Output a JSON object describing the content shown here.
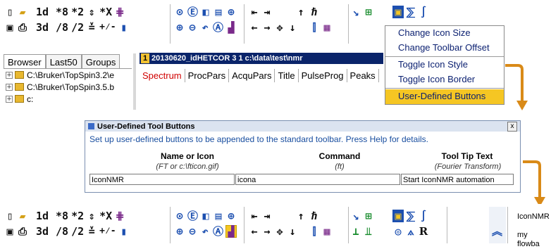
{
  "top_toolbar": {
    "row1": [
      "1d",
      "*8",
      "*2",
      "*X"
    ],
    "row2": [
      "3d",
      "/8",
      "/2"
    ]
  },
  "browser": {
    "tabs": [
      "Browser",
      "Last50",
      "Groups"
    ],
    "items": [
      "C:\\Bruker\\TopSpin3.2\\e",
      "C:\\Bruker\\TopSpin3.5.b",
      "c:"
    ]
  },
  "dataset": {
    "number": "1",
    "title": "20130620_idHETCOR 3 1 c:\\data\\test\\nmr",
    "tabs": [
      "Spectrum",
      "ProcPars",
      "AcquPars",
      "Title",
      "PulseProg",
      "Peaks"
    ]
  },
  "menu": {
    "items": [
      "Change Icon Size",
      "Change Toolbar Offset",
      "Toggle Icon Style",
      "Toggle Icon Border",
      "User-Defined Buttons"
    ]
  },
  "dialog": {
    "title": "User-Defined Tool Buttons",
    "close": "x",
    "description": "Set up user-defined buttons to be appended to the standard toolbar. Press Help for details.",
    "headers": [
      "Name or Icon",
      "Command",
      "Tool Tip Text"
    ],
    "subheaders": [
      "(FT or c:\\fticon.gif)",
      "(ft)",
      "(Fourier Transform)"
    ],
    "values": [
      "IconNMR",
      "icona",
      "Start IconNMR automation"
    ]
  },
  "bottom_toolbar": {
    "row1": [
      "1d",
      "*8",
      "*2",
      "*X"
    ],
    "row2": [
      "3d",
      "/8",
      "/2"
    ],
    "user_buttons": [
      "IconNMR",
      "my flowba"
    ]
  },
  "colors": {
    "highlight": "#f5c623",
    "title_bar": "#0a246a",
    "arrow": "#d98a18",
    "menu_text": "#0a1f70"
  }
}
